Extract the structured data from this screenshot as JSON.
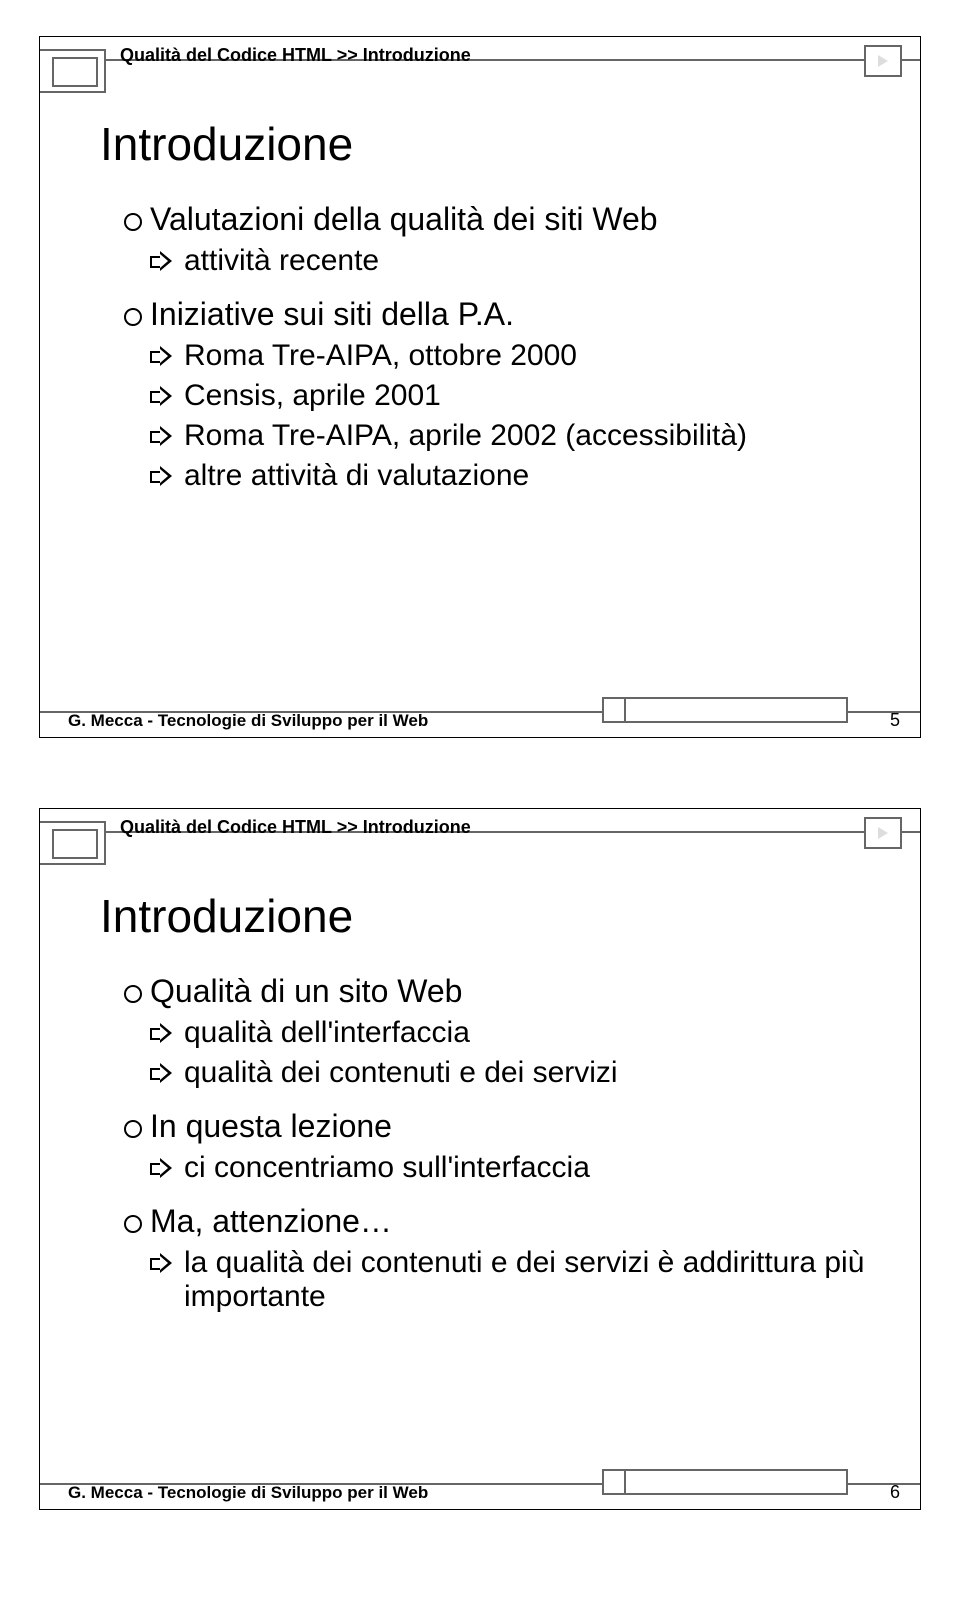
{
  "slide1": {
    "breadcrumb": "Qualità del Codice HTML >> Introduzione",
    "title": "Introduzione",
    "b1": "Valutazioni della qualità dei siti Web",
    "b1_1": "attività recente",
    "b2": "Iniziative sui siti della P.A.",
    "b2_1": "Roma Tre-AIPA, ottobre 2000",
    "b2_2": "Censis, aprile 2001",
    "b2_3": "Roma Tre-AIPA, aprile 2002 (accessibilità)",
    "b2_4": "altre attività di valutazione",
    "footer": "G. Mecca - Tecnologie di Sviluppo per il Web",
    "pagenum": "5"
  },
  "slide2": {
    "breadcrumb": "Qualità del Codice HTML >> Introduzione",
    "title": "Introduzione",
    "b1": "Qualità di un sito Web",
    "b1_1": "qualità dell'interfaccia",
    "b1_2": "qualità dei contenuti e dei servizi",
    "b2": "In questa lezione",
    "b2_1": "ci concentriamo sull'interfaccia",
    "b3": "Ma, attenzione…",
    "b3_1": "la qualità dei contenuti e dei servizi è addirittura più importante",
    "footer": "G. Mecca - Tecnologie di Sviluppo per il Web",
    "pagenum": "6"
  }
}
